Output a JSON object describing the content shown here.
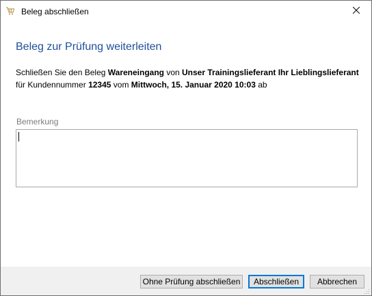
{
  "window": {
    "title": "Beleg abschließen",
    "app_icon": "cart-icon",
    "close_icon": "close-icon"
  },
  "dialog": {
    "heading": "Beleg zur Prüfung weiterleiten",
    "description": {
      "part1": "Schließen Sie den Beleg ",
      "document_type": "Wareneingang",
      "part2": " von ",
      "supplier": "Unser Trainingslieferant Ihr Lieblingslieferant",
      "part3": "für Kundennummer ",
      "customer_number": "12345",
      "part4": " vom ",
      "date": "Mittwoch, 15. Januar 2020 10:03",
      "part5": " ab"
    },
    "remark": {
      "label": "Bemerkung",
      "value": ""
    }
  },
  "buttons": {
    "skip_review_label": "Ohne Prüfung abschließen",
    "close_label": "Abschließen",
    "cancel_label": "Abbrechen"
  },
  "colors": {
    "heading": "#1f4e9a",
    "footer_bg": "#f0f0f0",
    "button_bg": "#e1e1e1",
    "default_button_border": "#0078d7"
  }
}
